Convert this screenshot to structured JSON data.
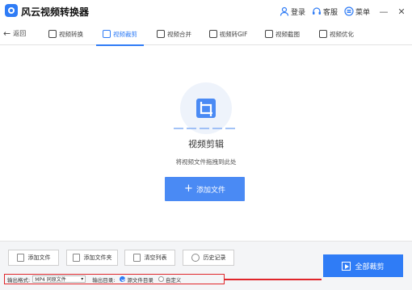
{
  "app": {
    "title": "风云视频转换器",
    "accent": "#2f7cf6",
    "login_label": "登录",
    "service_label": "客服",
    "menu_label": "菜单",
    "minimize": "—",
    "close": "✕"
  },
  "nav": {
    "back_label": "返回",
    "tabs": [
      {
        "label": "视频转换",
        "icon": "video-convert-icon"
      },
      {
        "label": "视频裁剪",
        "icon": "video-crop-icon",
        "active": true
      },
      {
        "label": "视频合并",
        "icon": "video-merge-icon"
      },
      {
        "label": "视频转GIF",
        "icon": "gif-icon"
      },
      {
        "label": "视频截图",
        "icon": "screenshot-icon"
      },
      {
        "label": "视频优化",
        "icon": "optimize-icon"
      }
    ]
  },
  "main": {
    "title": "视频剪辑",
    "hint": "将视频文件拖拽到此处",
    "add_button": "添加文件",
    "add_icon": "plus-icon"
  },
  "bottom": {
    "buttons": [
      {
        "label": "添加文件",
        "icon": "add-file-icon"
      },
      {
        "label": "添加文件夹",
        "icon": "add-folder-icon"
      },
      {
        "label": "清空列表",
        "icon": "trash-icon"
      },
      {
        "label": "历史记录",
        "icon": "history-icon"
      }
    ],
    "format_label": "输出格式:",
    "format_value": "MP4 同原文件",
    "dir_label": "输出目录:",
    "dir_options": [
      {
        "label": "源文件目录",
        "selected": true
      },
      {
        "label": "自定义",
        "selected": false
      }
    ],
    "crop_all": "全部裁剪",
    "highlight_color": "#e0262b"
  }
}
